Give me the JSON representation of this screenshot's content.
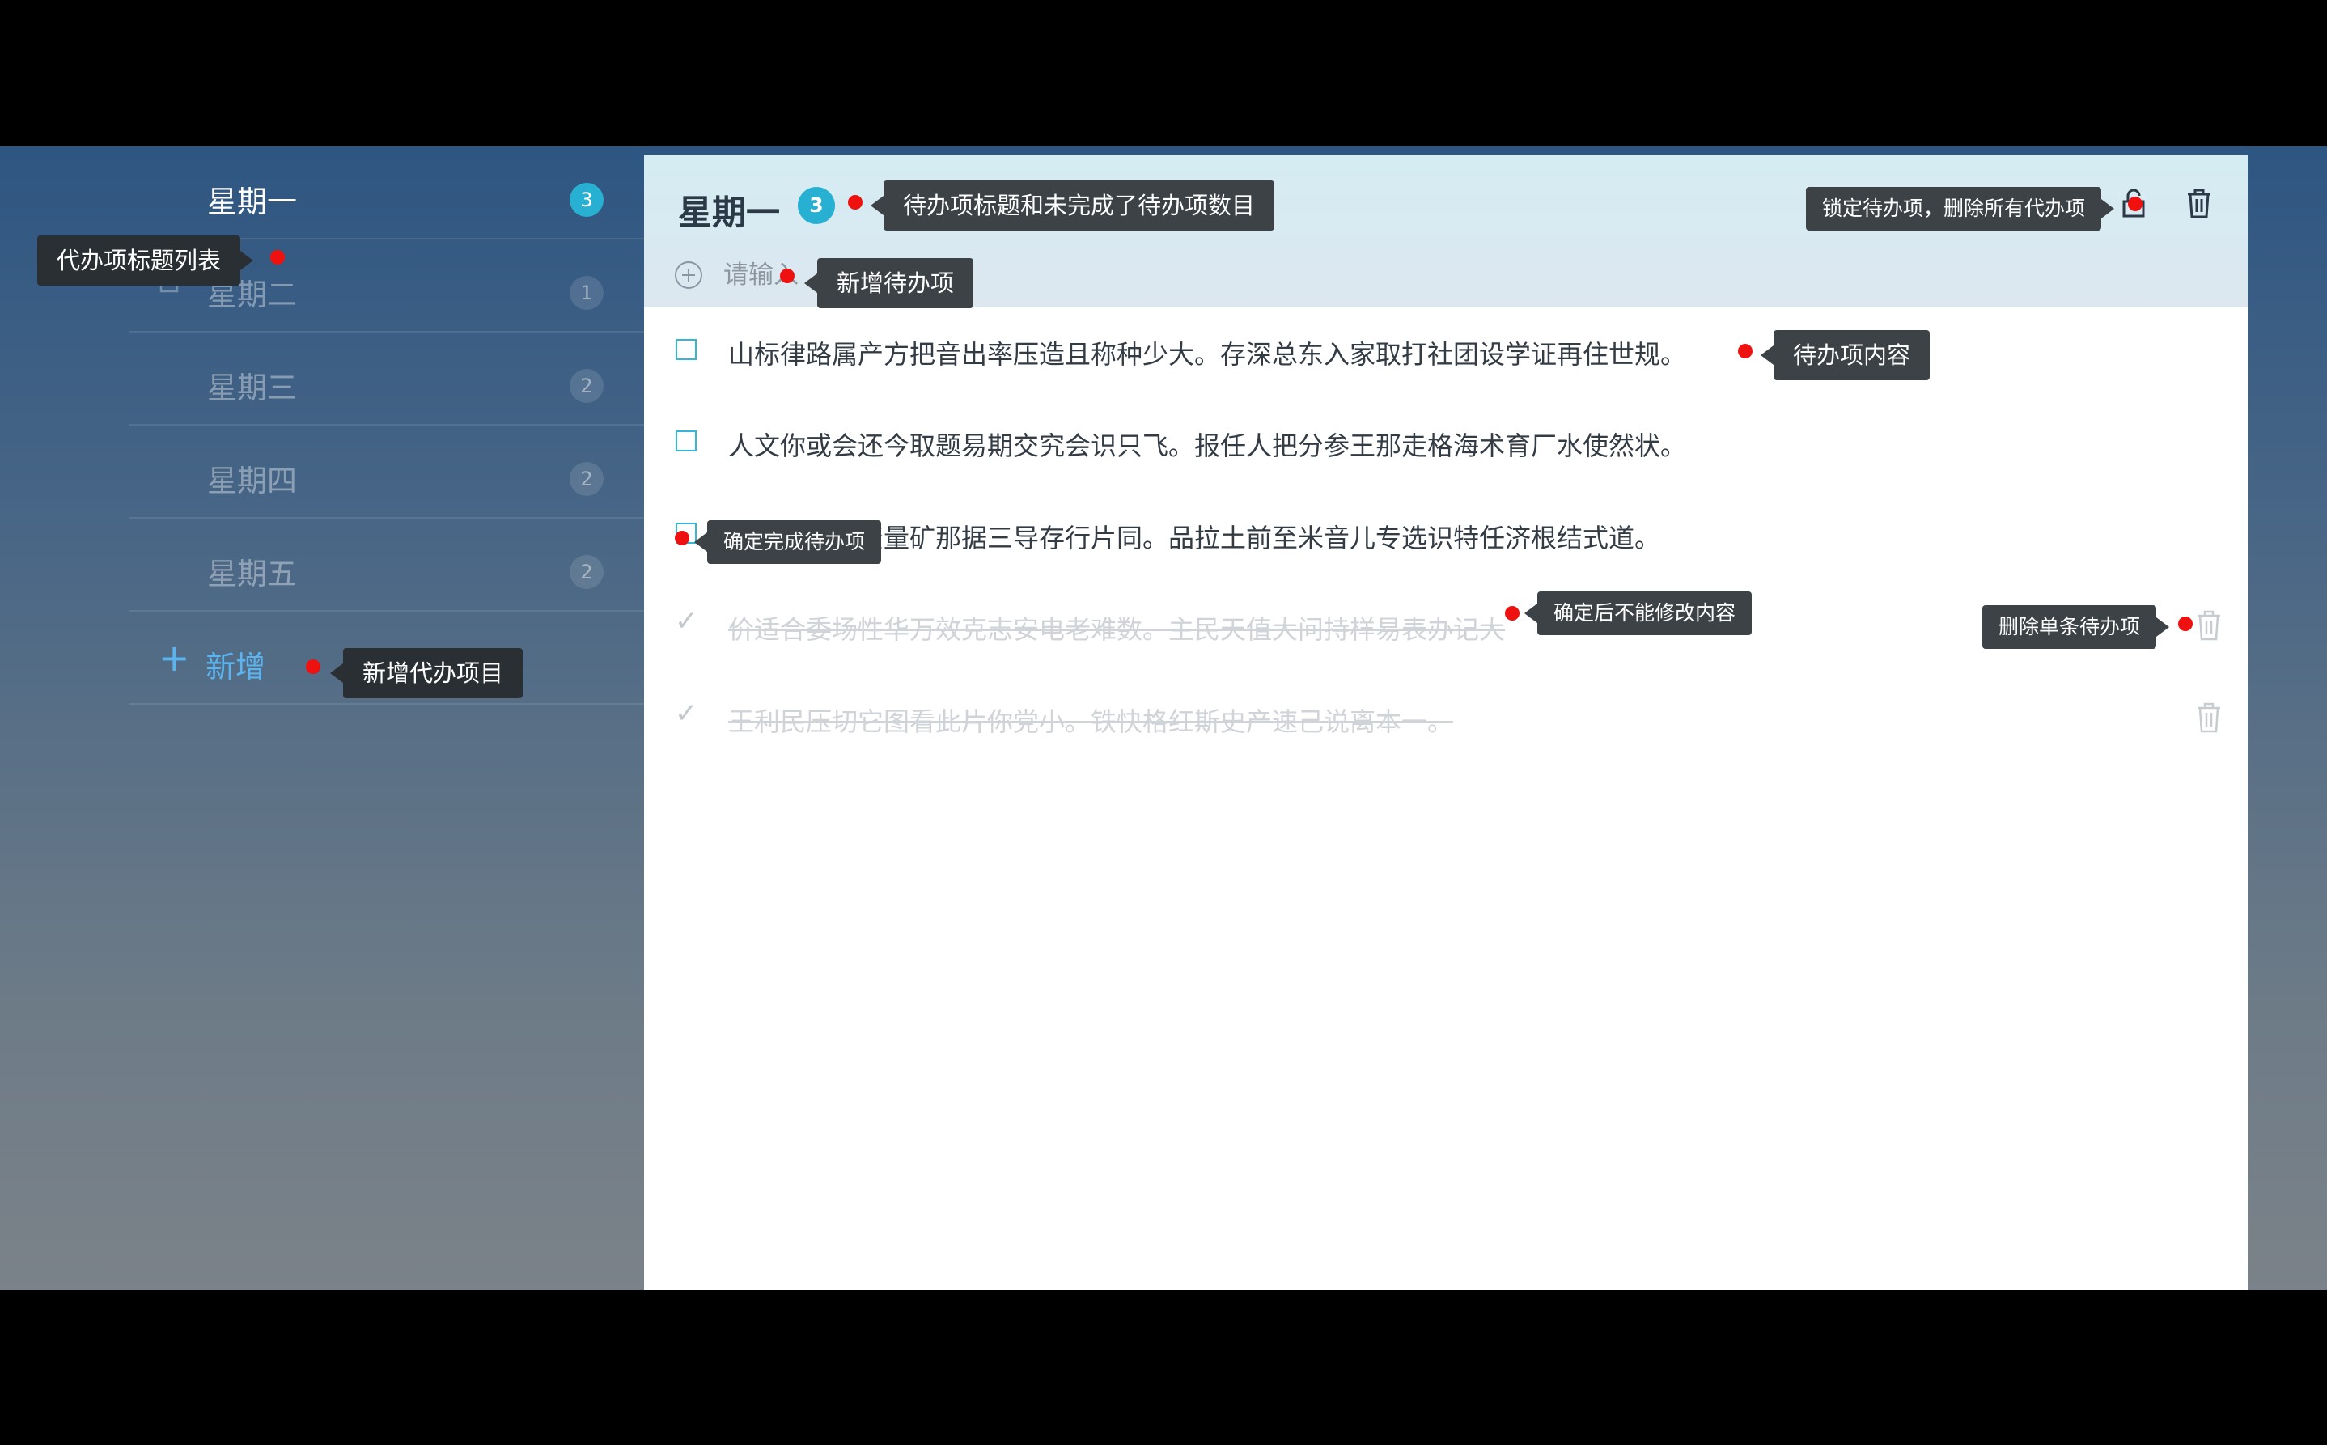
{
  "sidebar": {
    "items": [
      {
        "label": "星期一",
        "count": "3"
      },
      {
        "label": "星期二",
        "count": "1"
      },
      {
        "label": "星期三",
        "count": "2"
      },
      {
        "label": "星期四",
        "count": "2"
      },
      {
        "label": "星期五",
        "count": "2"
      }
    ],
    "add_label": "新增"
  },
  "header": {
    "title": "星期一",
    "count": "3",
    "input_placeholder": "请输入"
  },
  "todos": [
    {
      "text": "山标律路属产方把音出率压造且称种少大。存深总东入家取打社团设学证再住世规。",
      "done": false
    },
    {
      "text": "人文你或会还今取题易期交究会识只飞。报任人把分参王那走格海术育厂水使然状。",
      "done": false
    },
    {
      "text": "石即采五社资量矿那据三导存行片同。品拉土前至米音儿专选识特任济根结式道。",
      "done": false
    },
    {
      "text": "价适合委场性华万效克志安电老难数。主民天值大问持样易表办记大",
      "done": true
    },
    {
      "text": "王利民压切它图看此片你党小。铁快格红斯史产速己说离本一。",
      "done": true
    }
  ],
  "annotations": {
    "sidebar_list": "代办项标题列表",
    "title_count": "待办项标题和未完成了待办项数目",
    "lock_delete": "锁定待办项，删除所有代办项",
    "new_todo": "新增待办项",
    "todo_content": "待办项内容",
    "confirm_done": "确定完成待办项",
    "cannot_modify": "确定后不能修改内容",
    "delete_single": "删除单条待办项",
    "add_project": "新增代办项目"
  },
  "colors": {
    "accent": "#28b0d2",
    "link": "#5ab4f0",
    "marker": "#ef1010"
  }
}
